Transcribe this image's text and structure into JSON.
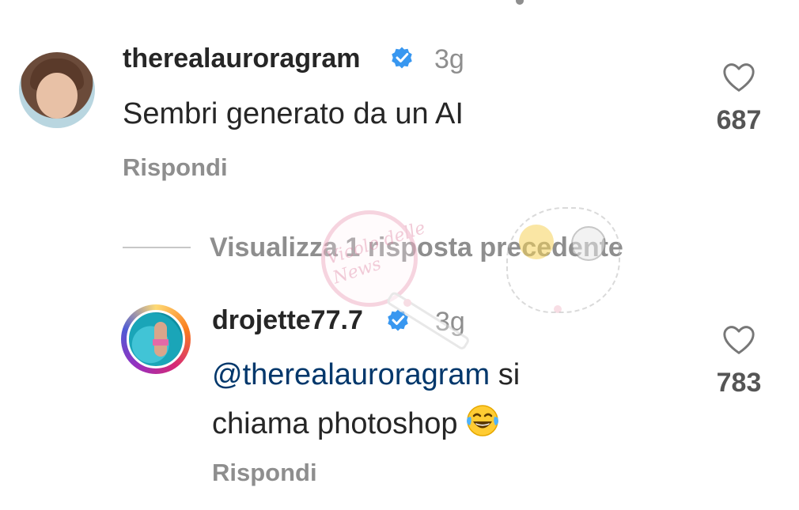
{
  "comments": [
    {
      "username": "therealauroragram",
      "verified": true,
      "time": "3g",
      "text": "Sembri generato da un AI",
      "reply_label": "Rispondi",
      "likes": "687"
    },
    {
      "username": "drojette77.7",
      "verified": true,
      "time": "3g",
      "mention": "@therealauroragram",
      "text_line1_rest": " si",
      "text_line2": "chiama photoshop",
      "emoji": "😂",
      "reply_label": "Rispondi",
      "likes": "783"
    }
  ],
  "thread": {
    "view_replies_label": "Visualizza 1 risposta precedente"
  },
  "watermark": {
    "text": "Vicolo delle News"
  },
  "colors": {
    "verified_blue": "#3897f0",
    "mention_blue": "#00376b",
    "secondary_gray": "#8e8e8e"
  },
  "icons": [
    "verified-badge-icon",
    "heart-icon",
    "face-with-tears-of-joy-emoji"
  ]
}
